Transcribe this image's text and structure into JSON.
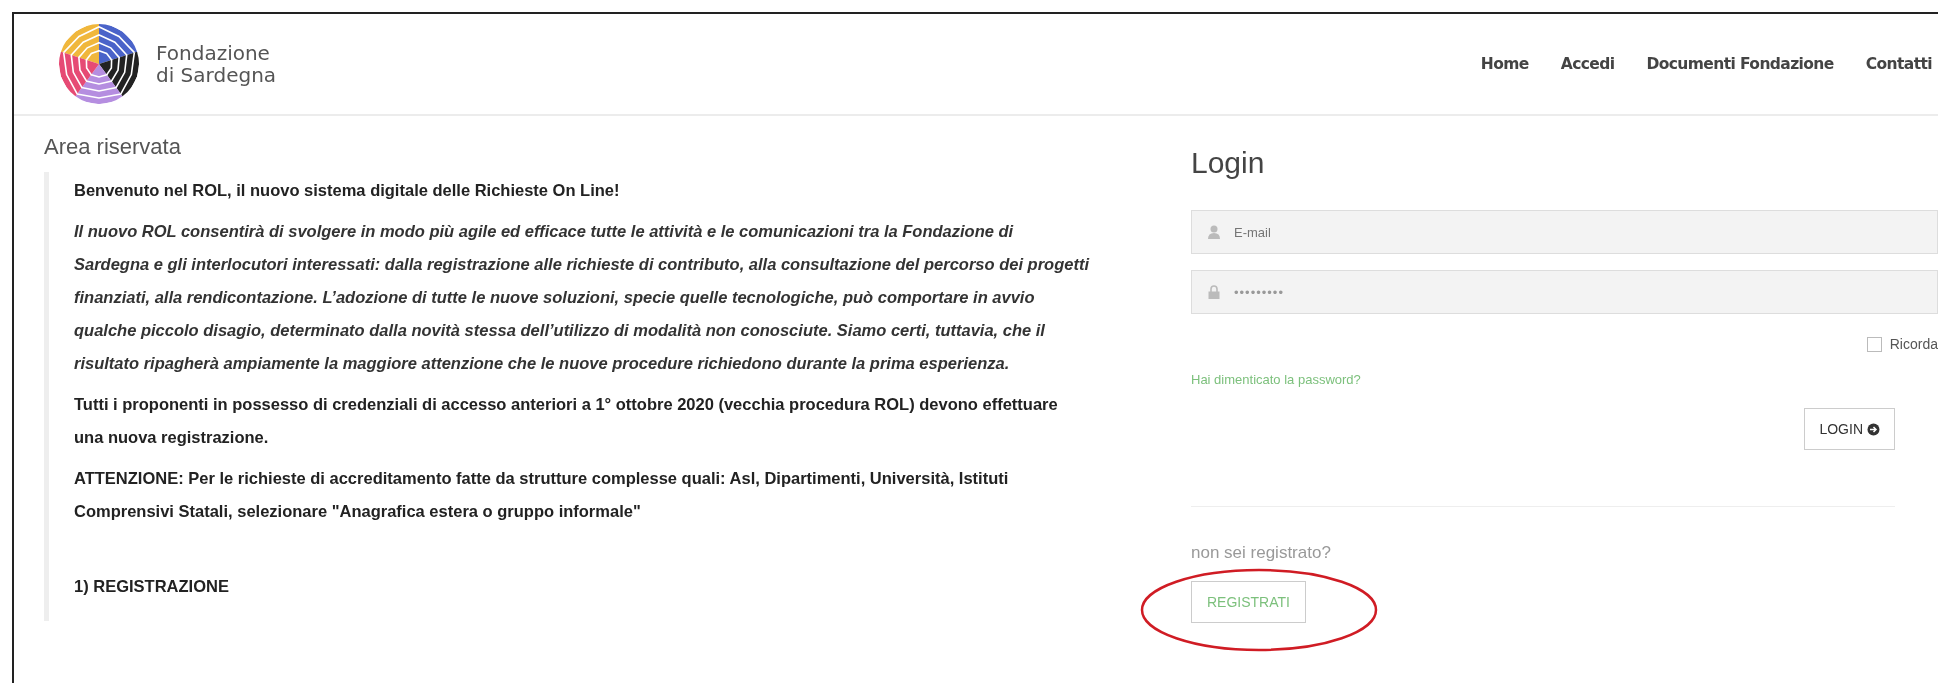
{
  "header": {
    "logo_line_1": "Fondazione",
    "logo_line_2": "di Sardegna",
    "nav": [
      {
        "label": "Home"
      },
      {
        "label": "Accedi"
      },
      {
        "label": "Documenti Fondazione"
      },
      {
        "label": "Contatti"
      }
    ]
  },
  "main": {
    "title": "Area riservata",
    "paragraphs": [
      {
        "kind": "bold",
        "text": "Benvenuto nel ROL, il nuovo sistema digitale delle Richieste On Line!"
      },
      {
        "kind": "italic",
        "text": "Il nuovo ROL consentirà di svolgere in modo più agile ed efficace tutte le attività e le comunicazioni tra la Fondazione di Sardegna e gli interlocutori interessati: dalla registrazione alle richieste di contributo, alla consultazione del percorso dei progetti finanziati, alla rendicontazione. L’adozione di tutte le nuove soluzioni, specie quelle tecnologiche, può comportare in avvio qualche piccolo disagio, determinato dalla novità stessa dell’utilizzo di modalità non conosciute. Siamo certi, tuttavia, che il risultato ripagherà ampiamente la maggiore attenzione che le nuove procedure richiedono durante la prima esperienza."
      },
      {
        "kind": "bold",
        "text": "Tutti i proponenti in possesso di credenziali di accesso anteriori a 1° ottobre 2020 (vecchia procedura ROL) devono effettuare una nuova registrazione."
      },
      {
        "kind": "bold",
        "text": "ATTENZIONE: Per le richieste di accreditamento fatte da  strutture complesse quali: Asl, Dipartimenti, Università, Istituti Comprensivi Statali,  selezionare  \"Anagrafica estera o gruppo informale\""
      },
      {
        "kind": "heading",
        "text": "1) REGISTRAZIONE"
      }
    ]
  },
  "login": {
    "title": "Login",
    "email": {
      "placeholder": "E-mail"
    },
    "password": {
      "value": "•••••••••"
    },
    "remember": {
      "label": "Ricorda",
      "checked": false
    },
    "forgot_link": "Hai dimenticato la password?",
    "login_button": "LOGIN",
    "register_prompt": "non sei registrato?",
    "register_button": "REGISTRATI",
    "register_highlight": {
      "kind": "ellipse"
    }
  }
}
